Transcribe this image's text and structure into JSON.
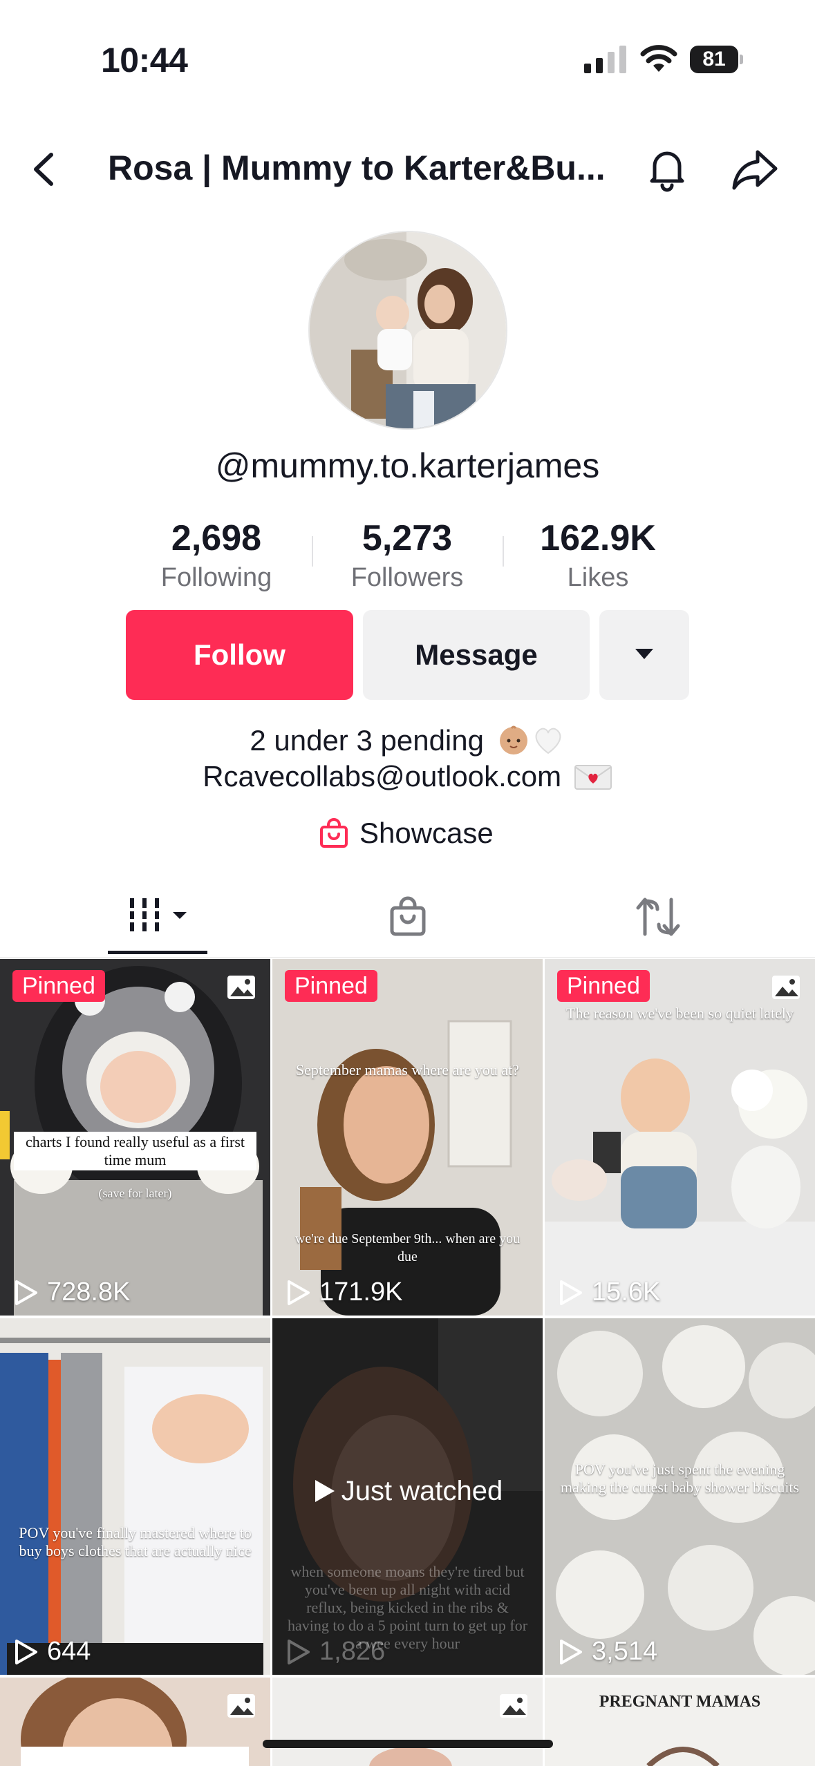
{
  "status_bar": {
    "time": "10:44",
    "battery": "81"
  },
  "nav": {
    "title": "Rosa | Mummy to Karter&Bu..."
  },
  "profile": {
    "username": "@mummy.to.karterjames",
    "stats": [
      {
        "value": "2,698",
        "label": "Following"
      },
      {
        "value": "5,273",
        "label": "Followers"
      },
      {
        "value": "162.9K",
        "label": "Likes"
      }
    ],
    "buttons": {
      "follow": "Follow",
      "message": "Message"
    },
    "bio": {
      "line1": "2 under 3 pending",
      "line2": "Rcavecollabs@outlook.com"
    },
    "showcase": "Showcase"
  },
  "tabs": [
    "videos-tab",
    "shop-tab",
    "reposts-tab"
  ],
  "videos": [
    {
      "pinned": "Pinned",
      "views": "728.8K",
      "caption": "charts I found really useful as a first time mum",
      "sub_caption": "(save for later)",
      "photo": true
    },
    {
      "pinned": "Pinned",
      "views": "171.9K",
      "caption": "September mamas where are you at?",
      "sub_caption": "we're due September 9th... when are you due",
      "photo": false
    },
    {
      "pinned": "Pinned",
      "views": "15.6K",
      "caption": "The reason we've been so quiet lately",
      "photo": true
    },
    {
      "views": "644",
      "caption": "POV you've finally mastered where to buy boys clothes that are actually nice"
    },
    {
      "views": "1,826",
      "overlay": "Just watched",
      "caption": "when someone moans they're tired but you've been up all night with acid reflux, being kicked in the ribs & having to do a 5 point turn to get up for a wee every hour"
    },
    {
      "views": "3,514",
      "caption": "POV you've just spent the evening making the cutest baby shower biscuits"
    },
    {
      "photo": true
    },
    {
      "photo": true
    },
    {
      "caption": "PREGNANT MAMAS"
    }
  ],
  "colors": {
    "accent": "#fe2c55",
    "text": "#161823",
    "muted": "#6f7076",
    "button_gray": "#f1f1f2"
  }
}
